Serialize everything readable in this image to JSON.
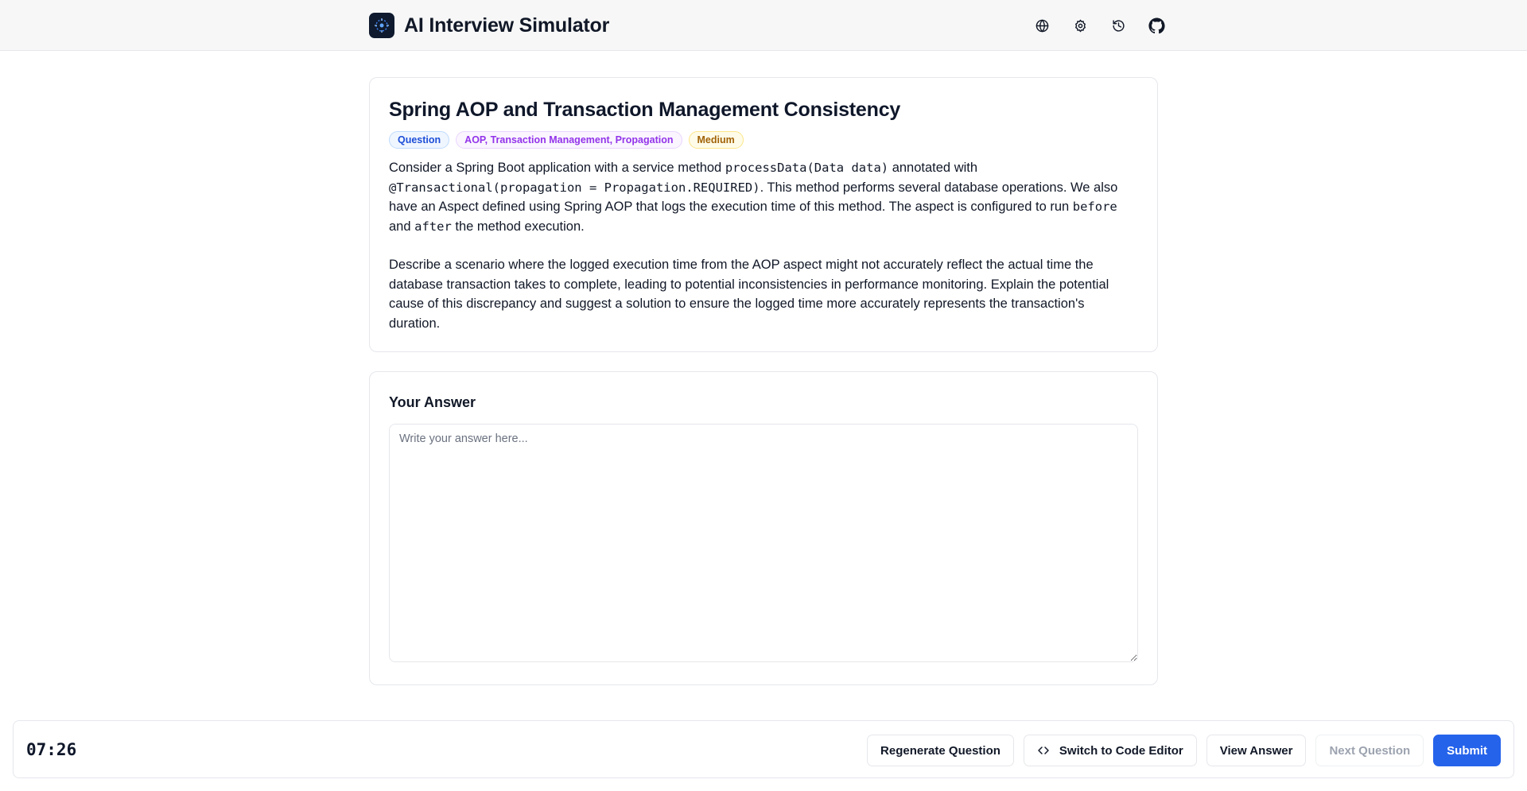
{
  "app": {
    "title": "AI Interview Simulator"
  },
  "header": {
    "icons": [
      "globe-icon",
      "gear-icon",
      "history-icon",
      "github-icon"
    ]
  },
  "question": {
    "title": "Spring AOP and Transaction Management Consistency",
    "tags": {
      "type": "Question",
      "topics": "AOP, Transaction Management, Propagation",
      "difficulty": "Medium"
    },
    "body": {
      "p1_text1": "Consider a Spring Boot application with a service method ",
      "p1_code1": "processData(Data data)",
      "p1_text2": " annotated with ",
      "p1_code2": "@Transactional(propagation = Propagation.REQUIRED)",
      "p1_text3": ". This method performs several database operations. We also have an Aspect defined using Spring AOP that logs the execution time of this method. The aspect is configured to run ",
      "p1_code3": "before",
      "p1_text4": " and ",
      "p1_code4": "after",
      "p1_text5": " the method execution.",
      "p2": "Describe a scenario where the logged execution time from the AOP aspect might not accurately reflect the actual time the database transaction takes to complete, leading to potential inconsistencies in performance monitoring. Explain the potential cause of this discrepancy and suggest a solution to ensure the logged time more accurately represents the transaction's duration."
    }
  },
  "answer": {
    "heading": "Your Answer",
    "placeholder": "Write your answer here...",
    "value": ""
  },
  "footer": {
    "timer": "07:26",
    "buttons": {
      "regenerate": "Regenerate Question",
      "switch_editor": "Switch to Code Editor",
      "view_answer": "View Answer",
      "next_question": "Next Question",
      "submit": "Submit"
    }
  },
  "colors": {
    "primary": "#2563eb",
    "tag_question": "#1d4ed8",
    "tag_topics": "#9333ea",
    "tag_difficulty": "#a16207"
  }
}
